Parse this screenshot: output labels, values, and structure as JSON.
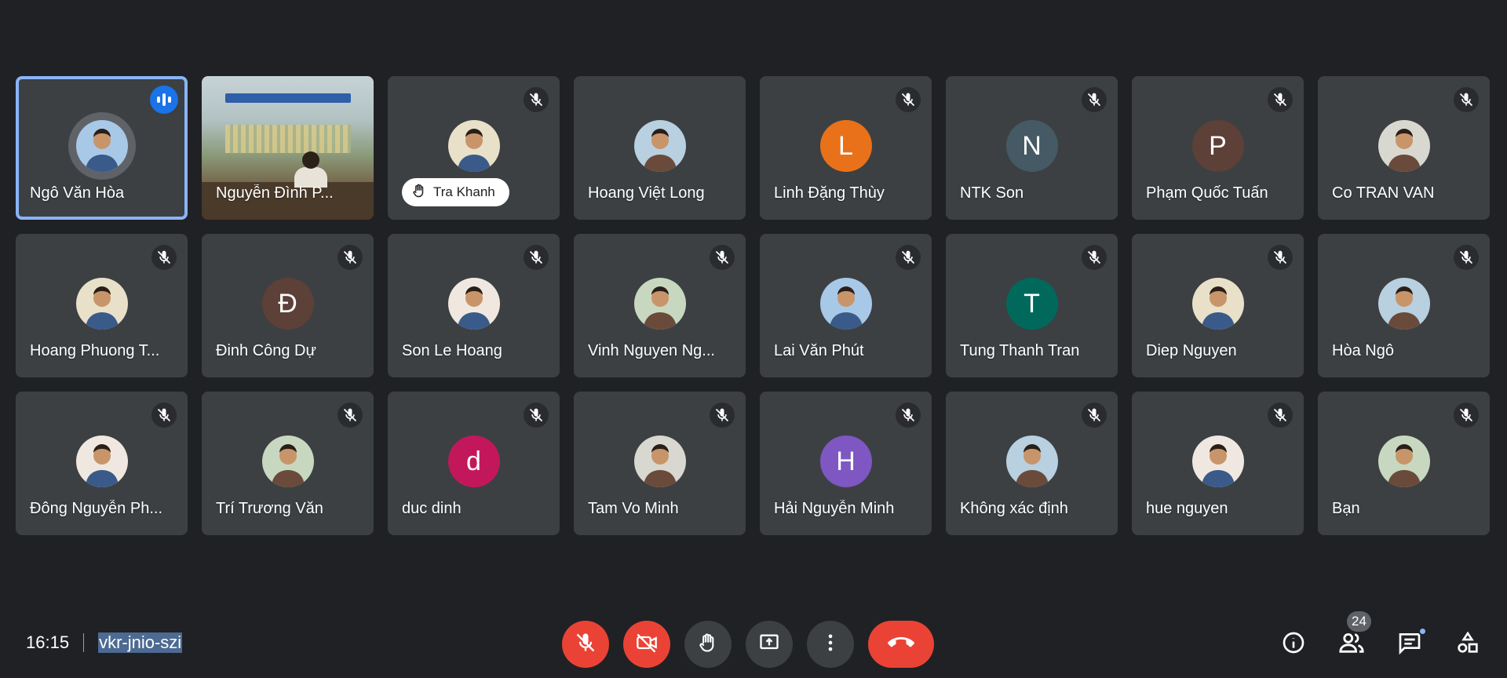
{
  "meeting": {
    "time": "16:15",
    "code": "vkr-jnio-szi",
    "participant_count": "24"
  },
  "participants": [
    {
      "name": "Ngô Văn Hòa",
      "type": "photo",
      "status": "speaking",
      "active": true
    },
    {
      "name": "Nguyễn Đình P...",
      "type": "video",
      "status": "none"
    },
    {
      "name": "Tra Khanh",
      "type": "photo",
      "status": "muted",
      "hand_raised": true
    },
    {
      "name": "Hoang Việt Long",
      "type": "photo",
      "status": "none"
    },
    {
      "name": "Linh Đặng Thùy",
      "type": "letter",
      "letter": "L",
      "color": "#e8711a",
      "status": "muted"
    },
    {
      "name": "NTK Son",
      "type": "letter",
      "letter": "N",
      "color": "#455a64",
      "status": "muted"
    },
    {
      "name": "Phạm Quốc Tuấn",
      "type": "letter",
      "letter": "P",
      "color": "#5d4037",
      "status": "muted"
    },
    {
      "name": "Co TRAN VAN",
      "type": "photo",
      "status": "muted"
    },
    {
      "name": "Hoang Phuong T...",
      "type": "photo",
      "status": "muted"
    },
    {
      "name": "Đinh Công Dự",
      "type": "letter",
      "letter": "Đ",
      "color": "#5d4037",
      "status": "muted"
    },
    {
      "name": "Son Le Hoang",
      "type": "photo",
      "status": "muted"
    },
    {
      "name": "Vinh Nguyen Ng...",
      "type": "photo",
      "status": "muted"
    },
    {
      "name": "Lai Văn Phút",
      "type": "photo",
      "status": "muted"
    },
    {
      "name": "Tung Thanh Tran",
      "type": "letter",
      "letter": "T",
      "color": "#00695c",
      "status": "muted"
    },
    {
      "name": "Diep Nguyen",
      "type": "photo",
      "status": "muted"
    },
    {
      "name": "Hòa Ngô",
      "type": "photo",
      "status": "muted"
    },
    {
      "name": "Đông Nguyễn Ph...",
      "type": "photo",
      "status": "muted"
    },
    {
      "name": "Trí Trương Văn",
      "type": "photo",
      "status": "muted"
    },
    {
      "name": "duc dinh",
      "type": "letter",
      "letter": "d",
      "color": "#c2185b",
      "status": "muted"
    },
    {
      "name": "Tam Vo Minh",
      "type": "photo",
      "status": "muted"
    },
    {
      "name": "Hải Nguyễn Minh",
      "type": "letter",
      "letter": "H",
      "color": "#7e57c2",
      "status": "muted"
    },
    {
      "name": "Không xác định",
      "type": "photo",
      "status": "muted"
    },
    {
      "name": "hue nguyen",
      "type": "photo",
      "status": "muted"
    },
    {
      "name": "Bạn",
      "type": "photo",
      "status": "muted"
    }
  ],
  "controls": [
    {
      "icon": "mic-off-icon",
      "style": "red"
    },
    {
      "icon": "camera-off-icon",
      "style": "red"
    },
    {
      "icon": "raise-hand-icon",
      "style": "default"
    },
    {
      "icon": "present-screen-icon",
      "style": "default"
    },
    {
      "icon": "more-options-icon",
      "style": "default"
    },
    {
      "icon": "end-call-icon",
      "style": "end"
    }
  ],
  "right_icons": [
    "info-icon",
    "people-icon",
    "chat-icon",
    "activities-icon"
  ],
  "colors": {
    "background": "#202124",
    "tile": "#3c4043",
    "active_outline": "#8ab4f8",
    "speaking": "#1a73e8",
    "danger": "#ea4335"
  }
}
